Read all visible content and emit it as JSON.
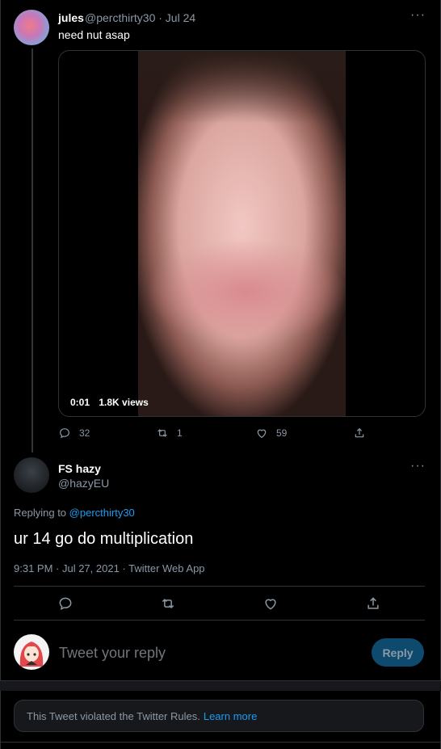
{
  "tweet1": {
    "name": "jules",
    "handle": "@percthirty30",
    "date": "· Jul 24",
    "text": "need nut asap",
    "video": {
      "time": "0:01",
      "views": "1.8K views"
    },
    "actions": {
      "replies": "32",
      "retweets": "1",
      "likes": "59"
    },
    "more": "···"
  },
  "tweet2": {
    "name": "FS hazy",
    "handle": "@hazyEU",
    "replying_prefix": "Replying to ",
    "replying_to": "@percthirty30",
    "text": "ur 14 go do multiplication",
    "meta": "9:31 PM · Jul 27, 2021 · Twitter Web App",
    "more": "···"
  },
  "composer": {
    "placeholder": "Tweet your reply",
    "button": "Reply"
  },
  "notice": {
    "text": "This Tweet violated the Twitter Rules.",
    "link": "Learn more"
  },
  "colors": {
    "background": "#000000",
    "accent": "#1d9bf0",
    "muted": "#8b98a5"
  },
  "icons": [
    "more-icon",
    "reply-icon",
    "retweet-icon",
    "like-icon",
    "share-icon"
  ]
}
